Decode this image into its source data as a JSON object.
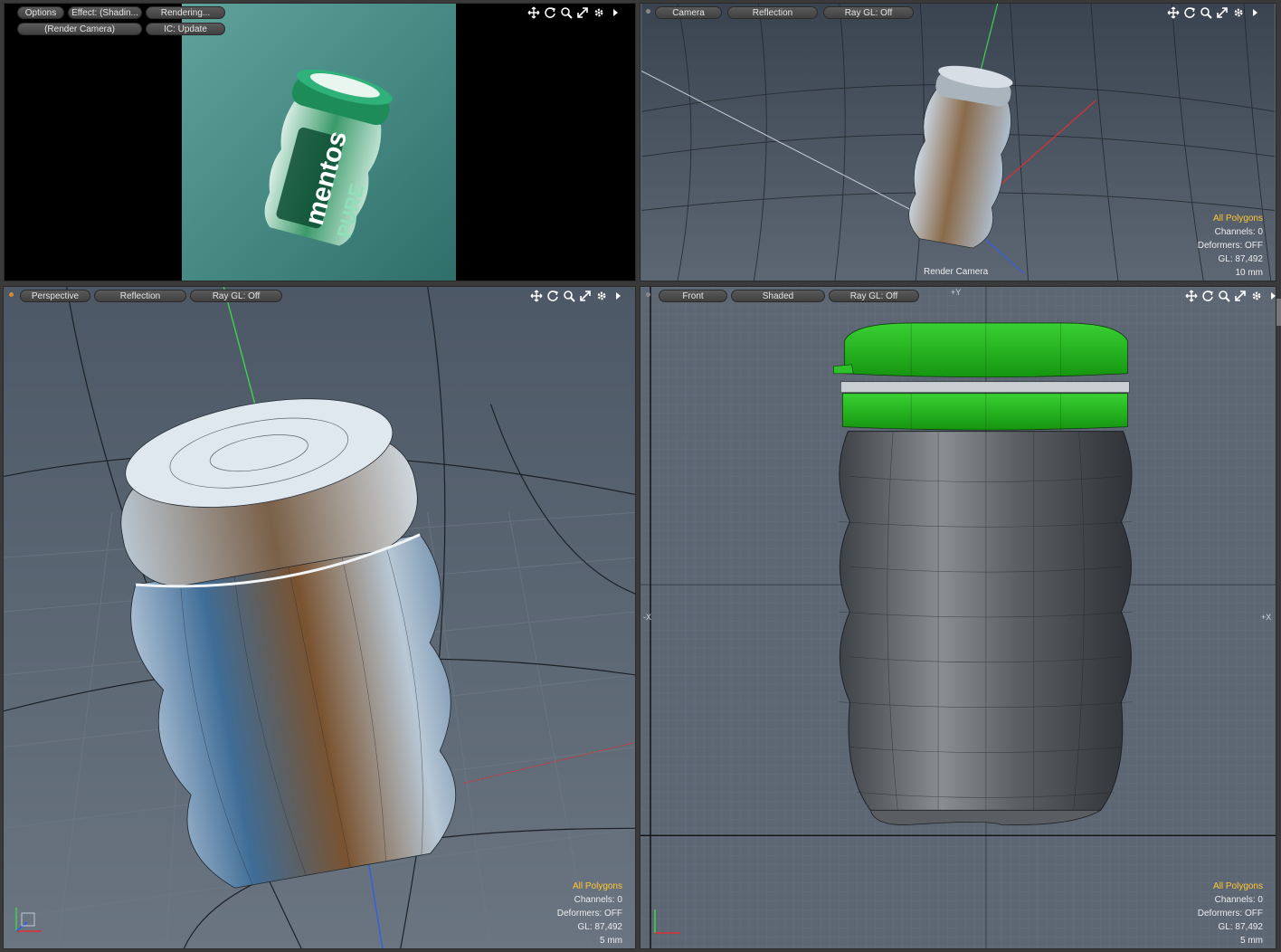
{
  "render_view": {
    "buttons": {
      "options": "Options",
      "effect": "Effect: (Shadin...",
      "rendering": "Rendering...",
      "camera": "(Render Camera)",
      "ic": "IC: Update"
    },
    "label": {
      "brand": "mentos",
      "sub": "PURE"
    }
  },
  "camera_view": {
    "buttons": {
      "view": "Camera",
      "shading": "Reflection",
      "raygl": "Ray GL: Off"
    },
    "caption": "Render Camera",
    "info": {
      "polygons": "All Polygons",
      "channels": "Channels: 0",
      "deformers": "Deformers: OFF",
      "gl": "GL: 87,492",
      "scale": "10 mm"
    }
  },
  "perspective_view": {
    "buttons": {
      "view": "Perspective",
      "shading": "Reflection",
      "raygl": "Ray GL: Off"
    },
    "info": {
      "polygons": "All Polygons",
      "channels": "Channels: 0",
      "deformers": "Deformers: OFF",
      "gl": "GL: 87,492",
      "scale": "5 mm"
    }
  },
  "front_view": {
    "buttons": {
      "view": "Front",
      "shading": "Shaded",
      "raygl": "Ray GL: Off"
    },
    "axes": {
      "top": "+Y",
      "left": "-X",
      "right": "+X"
    },
    "info": {
      "polygons": "All Polygons",
      "channels": "Channels: 0",
      "deformers": "Deformers: OFF",
      "gl": "GL: 87,492",
      "scale": "5 mm"
    }
  },
  "icons": [
    "move-icon",
    "rotate-icon",
    "zoom-icon",
    "maximize-icon",
    "settings-icon",
    "menu-arrow-icon"
  ],
  "colors": {
    "accent": "#ffc632",
    "cap_green": "#22b11e",
    "render_bg": "#3b8a80"
  }
}
